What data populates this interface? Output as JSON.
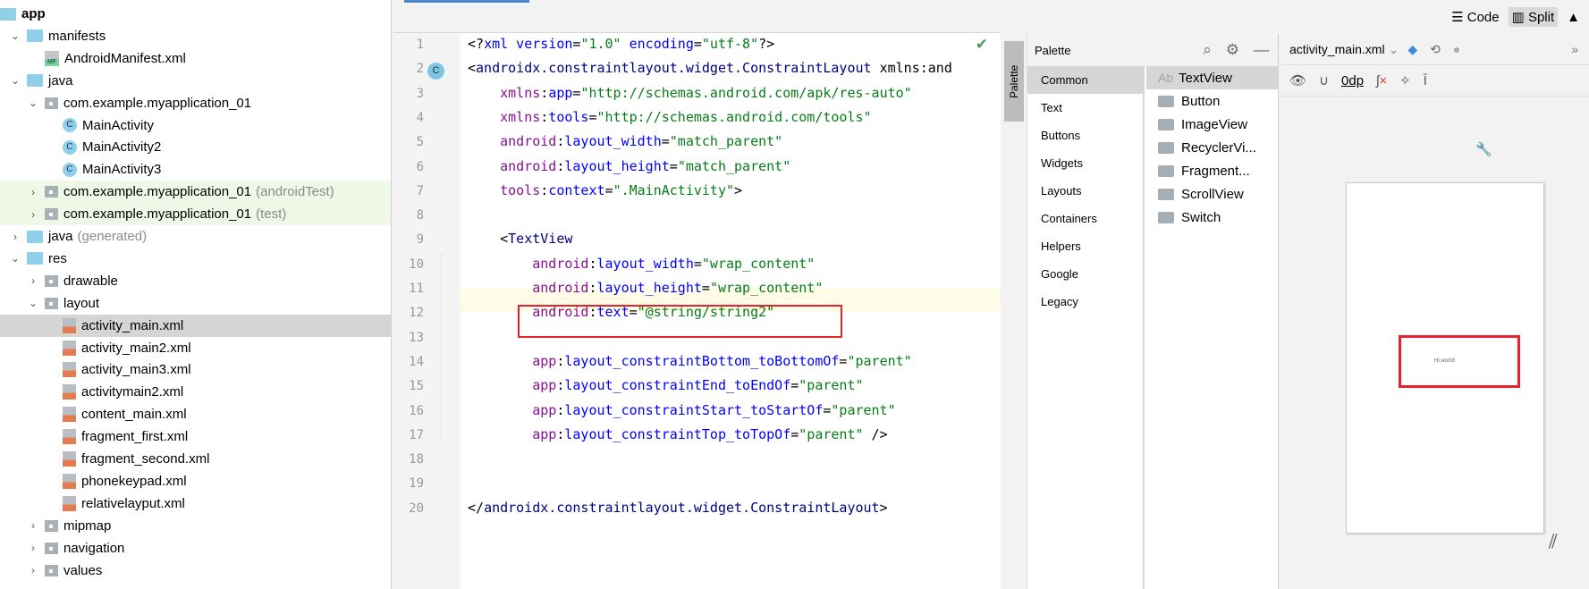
{
  "tree": {
    "items": [
      {
        "label": "app",
        "kind": "module",
        "expanded": true
      },
      {
        "label": "manifests",
        "kind": "folder",
        "expanded": true
      },
      {
        "label": "AndroidManifest.xml",
        "kind": "manifest"
      },
      {
        "label": "java",
        "kind": "folder",
        "expanded": true
      },
      {
        "label": "com.example.myapplication_01",
        "kind": "package",
        "expanded": true
      },
      {
        "label": "MainActivity",
        "kind": "class"
      },
      {
        "label": "MainActivity2",
        "kind": "class"
      },
      {
        "label": "MainActivity3",
        "kind": "class"
      },
      {
        "label": "com.example.myapplication_01",
        "suffix": "(androidTest)",
        "kind": "package"
      },
      {
        "label": "com.example.myapplication_01",
        "suffix": "(test)",
        "kind": "package"
      },
      {
        "label": "java",
        "suffix": "(generated)",
        "kind": "folder-gen"
      },
      {
        "label": "res",
        "kind": "folder",
        "expanded": true
      },
      {
        "label": "drawable",
        "kind": "package"
      },
      {
        "label": "layout",
        "kind": "package",
        "expanded": true
      },
      {
        "label": "activity_main.xml",
        "kind": "xml",
        "selected": true
      },
      {
        "label": "activity_main2.xml",
        "kind": "xml"
      },
      {
        "label": "activity_main3.xml",
        "kind": "xml"
      },
      {
        "label": "activitymain2.xml",
        "kind": "xml"
      },
      {
        "label": "content_main.xml",
        "kind": "xml"
      },
      {
        "label": "fragment_first.xml",
        "kind": "xml"
      },
      {
        "label": "fragment_second.xml",
        "kind": "xml"
      },
      {
        "label": "phonekeypad.xml",
        "kind": "xml"
      },
      {
        "label": "relativelayput.xml",
        "kind": "xml"
      },
      {
        "label": "mipmap",
        "kind": "package"
      },
      {
        "label": "navigation",
        "kind": "package"
      },
      {
        "label": "values",
        "kind": "package"
      }
    ],
    "class_icon": "C",
    "manifest_icon": "MF"
  },
  "editor": {
    "gutter_badge": "C",
    "lines": [
      "<?xml version=\"1.0\" encoding=\"utf-8\"?>",
      "<androidx.constraintlayout.widget.ConstraintLayout xmlns:and",
      "    xmlns:app=\"http://schemas.android.com/apk/res-auto\"",
      "    xmlns:tools=\"http://schemas.android.com/tools\"",
      "    android:layout_width=\"match_parent\"",
      "    android:layout_height=\"match_parent\"",
      "    tools:context=\".MainActivity\">",
      "",
      "    <TextView",
      "        android:layout_width=\"wrap_content\"",
      "        android:layout_height=\"wrap_content\"",
      "        android:text=\"@string/string2\"",
      "",
      "        app:layout_constraintBottom_toBottomOf=\"parent\"",
      "        app:layout_constraintEnd_toEndOf=\"parent\"",
      "        app:layout_constraintStart_toStartOf=\"parent\"",
      "        app:layout_constraintTop_toTopOf=\"parent\" />",
      "",
      "",
      "</androidx.constraintlayout.widget.ConstraintLayout>"
    ],
    "current_line": 13,
    "highlight_color": "#e8222a"
  },
  "view_modes": {
    "code": "Code",
    "split": "Split",
    "selected": "Split"
  },
  "palette": {
    "strip_label": "Palette",
    "title": "Palette",
    "categories": [
      "Common",
      "Text",
      "Buttons",
      "Widgets",
      "Layouts",
      "Containers",
      "Helpers",
      "Google",
      "Legacy"
    ],
    "items": [
      {
        "icon": "Ab",
        "label": "TextView"
      },
      {
        "label": "Button"
      },
      {
        "label": "ImageView"
      },
      {
        "label": "RecyclerVi..."
      },
      {
        "label": "Fragment..."
      },
      {
        "label": "ScrollView"
      },
      {
        "label": "Switch"
      }
    ]
  },
  "design": {
    "file": "activity_main.xml",
    "margin": "0dp",
    "preview_text": "Hi,world!"
  }
}
